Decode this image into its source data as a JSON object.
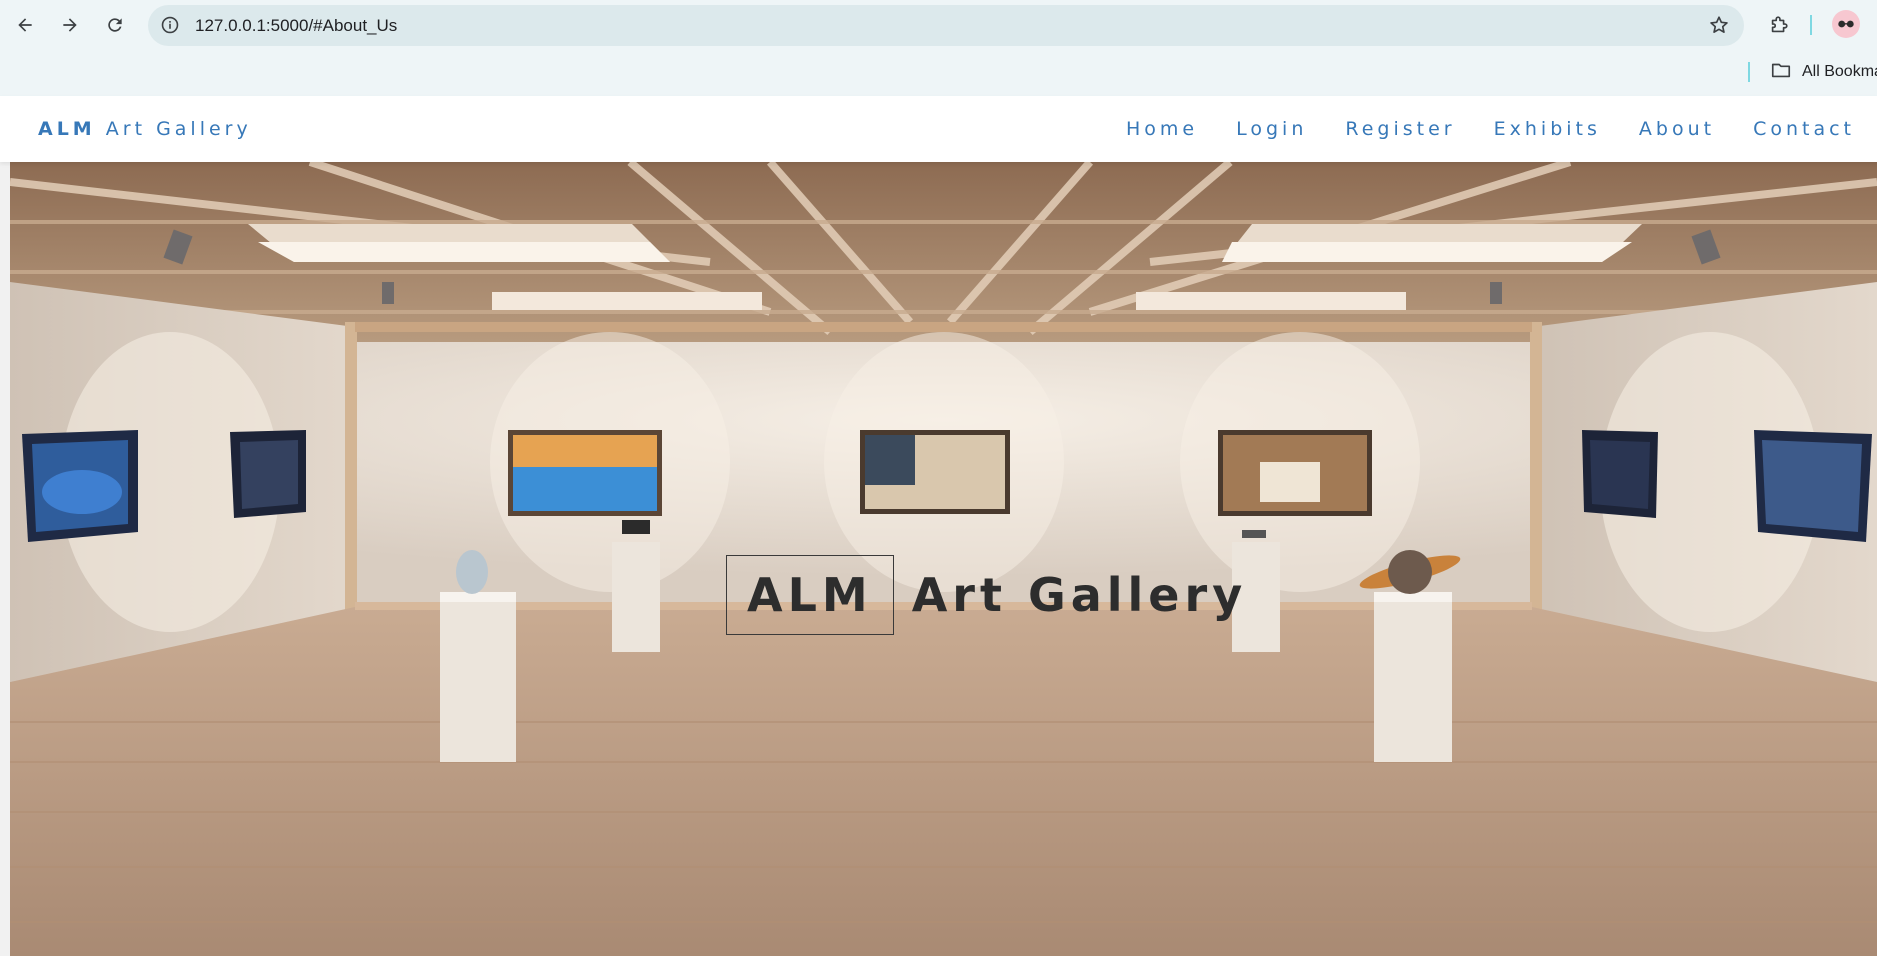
{
  "browser": {
    "url": "127.0.0.1:5000/#About_Us",
    "bookmarks_label": "All Bookma",
    "icons": {
      "back": "back-arrow-icon",
      "forward": "forward-arrow-icon",
      "reload": "reload-icon",
      "site_info": "site-info-icon",
      "bookmark": "star-icon",
      "extensions": "puzzle-icon",
      "profile": "avatar",
      "folder": "folder-icon"
    }
  },
  "nav": {
    "brand_strong": "ALM",
    "brand_rest": "Art Gallery",
    "links": [
      "Home",
      "Login",
      "Register",
      "Exhibits",
      "About",
      "Contact"
    ]
  },
  "hero": {
    "title_boxed": "ALM",
    "title_rest": "Art Gallery"
  },
  "colors": {
    "brand_blue": "#3778b8",
    "chrome_bg": "#eef5f7",
    "omnibox_bg": "#dce9ec",
    "hero_text": "#2d2d2d"
  }
}
